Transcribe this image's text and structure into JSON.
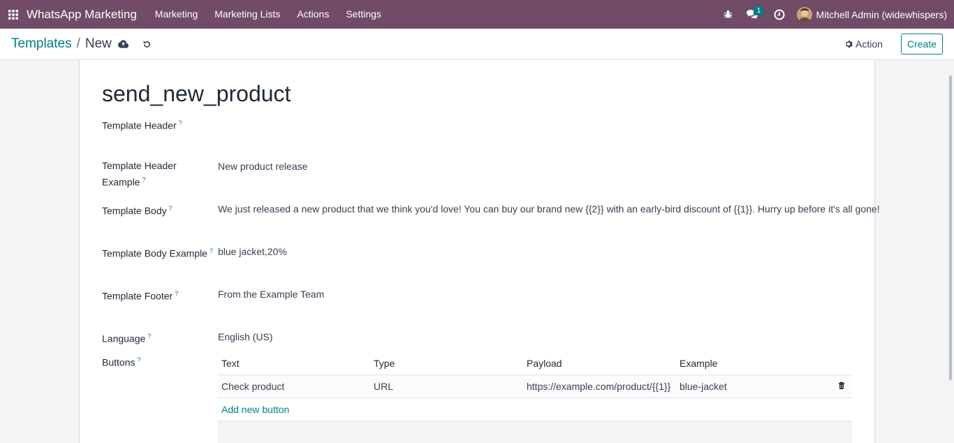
{
  "navbar": {
    "app_name": "WhatsApp Marketing",
    "menu": [
      "Marketing",
      "Marketing Lists",
      "Actions",
      "Settings"
    ],
    "message_count": "1",
    "user_name": "Mitchell Admin (widewhispers)"
  },
  "breadcrumb": {
    "parent": "Templates",
    "separator": "/",
    "current": "New"
  },
  "control": {
    "action_label": "Action",
    "create_label": "Create"
  },
  "record": {
    "title": "send_new_product",
    "help_mark": "?",
    "labels": {
      "header": "Template Header",
      "header_example": "Template Header Example",
      "body": "Template Body",
      "body_example": "Template Body Example",
      "footer": "Template Footer",
      "language": "Language",
      "buttons": "Buttons"
    },
    "values": {
      "header_example": "New product release",
      "body": "We just released a new product that we think you'd love! You can buy our brand new {{2}} with an early-bird discount of {{1}}. Hurry up before it's all gone!",
      "body_example": "blue jacket,20%",
      "footer": "From the Example Team",
      "language": "English (US)"
    }
  },
  "buttons_table": {
    "columns": [
      "Text",
      "Type",
      "Payload",
      "Example"
    ],
    "rows": [
      {
        "text": "Check product",
        "type": "URL",
        "payload": "https://example.com/product/{{1}}",
        "example": "blue-jacket"
      }
    ],
    "add_label": "Add new button"
  },
  "colors": {
    "navbar": "#714b67",
    "accent": "#017e84"
  }
}
